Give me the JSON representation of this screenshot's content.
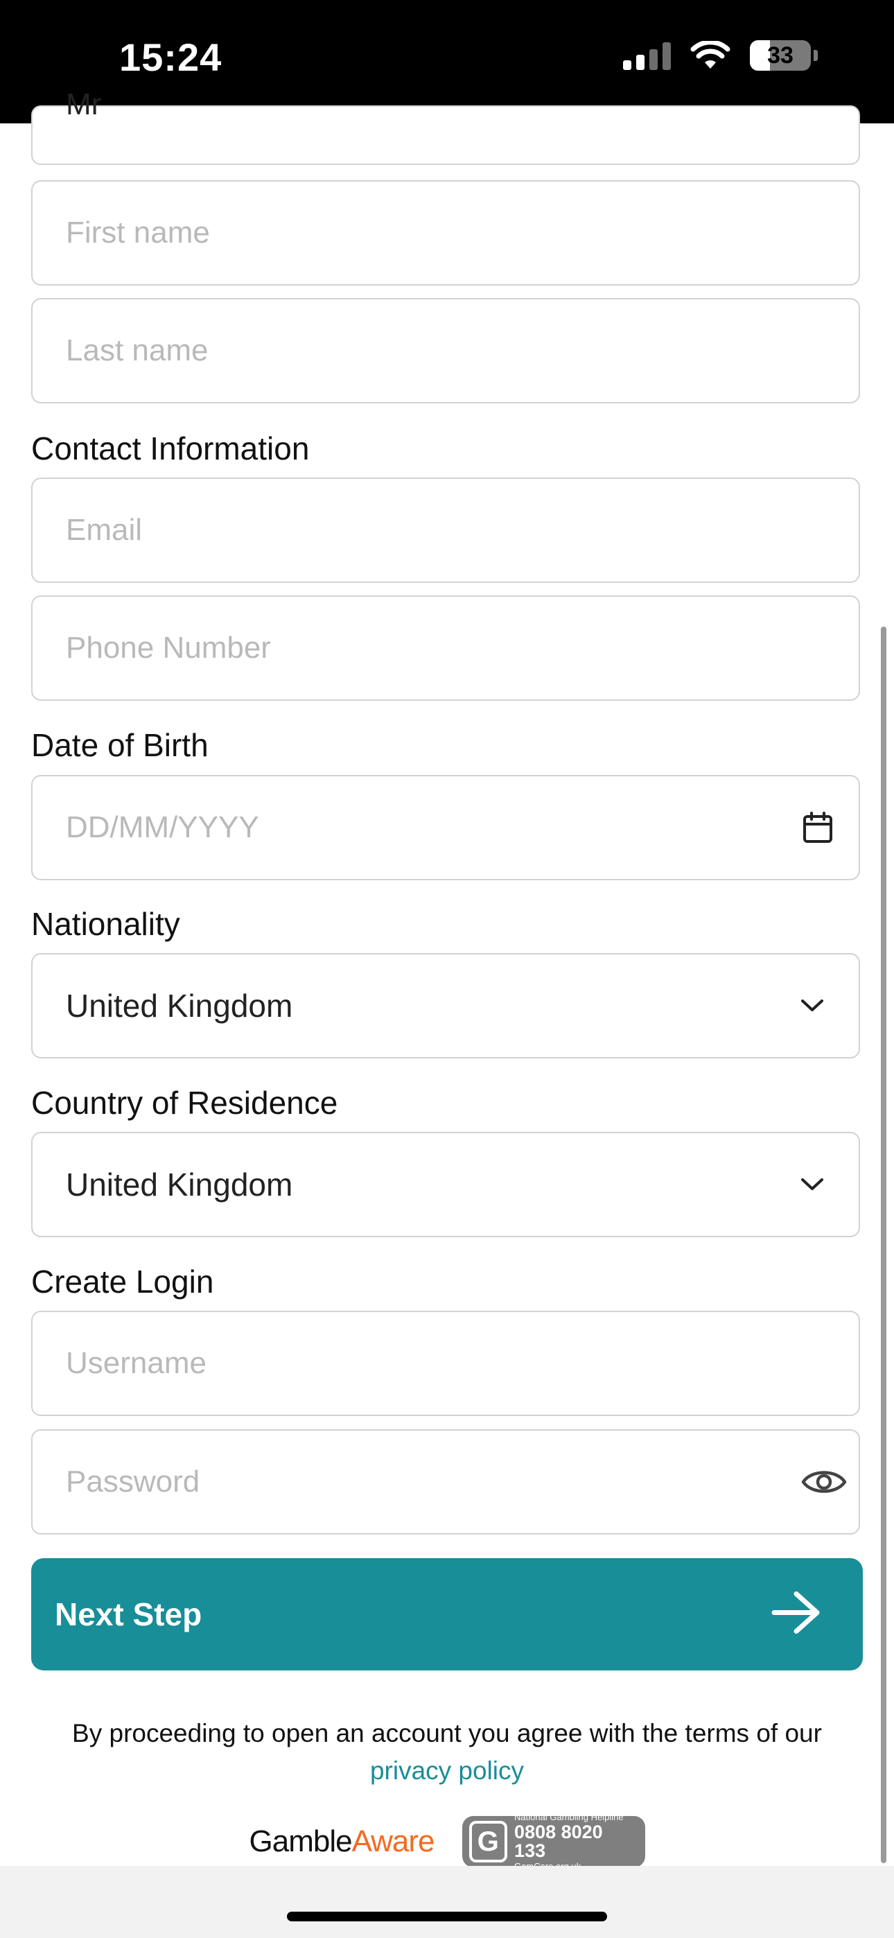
{
  "status_bar": {
    "time": "15:24",
    "battery": "33",
    "battery_level": 0.33
  },
  "form": {
    "title_field": {
      "value": "Mr"
    },
    "first_name": {
      "placeholder": "First name"
    },
    "last_name": {
      "placeholder": "Last name"
    },
    "contact_section": "Contact Information",
    "email": {
      "placeholder": "Email"
    },
    "phone": {
      "placeholder": "Phone Number"
    },
    "dob_section": "Date of Birth",
    "dob": {
      "placeholder": "DD/MM/YYYY"
    },
    "nationality_section": "Nationality",
    "nationality": {
      "value": "United Kingdom"
    },
    "residence_section": "Country of Residence",
    "residence": {
      "value": "United Kingdom"
    },
    "login_section": "Create Login",
    "username": {
      "placeholder": "Username"
    },
    "password": {
      "placeholder": "Password"
    }
  },
  "next_button": {
    "label": "Next Step"
  },
  "terms": {
    "text": "By proceeding to open an account you agree with the terms of our",
    "link": "privacy policy"
  },
  "logos": {
    "gamble_aware_1": "Gamble",
    "gamble_aware_2": "Aware",
    "gamcare_badge": "G",
    "gamcare_line1": "National Gambling Helpline",
    "gamcare_phone": "0808 8020 133",
    "gamcare_site": "GamCare.org.uk"
  },
  "colors": {
    "accent": "#188e98",
    "gamble_aware_orange": "#f26a21"
  },
  "icons": {
    "dob": "calendar-icon",
    "dropdown": "chevron-down-icon",
    "password": "eye-icon",
    "button": "arrow-right-icon"
  }
}
